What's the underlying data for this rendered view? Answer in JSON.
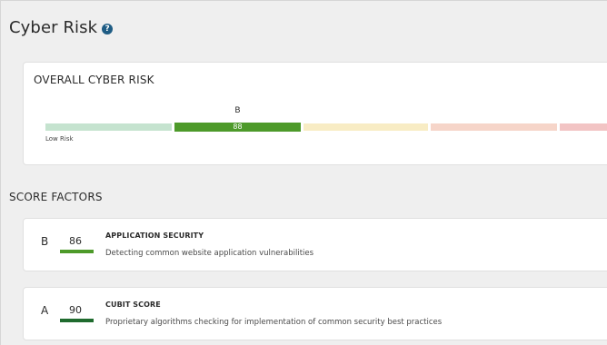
{
  "page": {
    "title": "Cyber Risk",
    "help_icon": "question-icon",
    "help_glyph": "?"
  },
  "overall": {
    "title": "OVERALL CYBER RISK",
    "scale": [
      {
        "color": "#c5e3cf"
      },
      {
        "color": "#4d9a2a",
        "current": true
      },
      {
        "color": "#f8ecc4"
      },
      {
        "color": "#f6d5c9"
      },
      {
        "color": "#f2c4c4"
      }
    ],
    "current_grade": "B",
    "current_score": "88",
    "low_label": "Low Risk"
  },
  "score_factors": {
    "title": "SCORE FACTORS",
    "items": [
      {
        "grade": "B",
        "score": "86",
        "bar_color": "#4d9a2a",
        "name": "APPLICATION SECURITY",
        "description": "Detecting common website application vulnerabilities"
      },
      {
        "grade": "A",
        "score": "90",
        "bar_color": "#1f6b2e",
        "name": "CUBIT SCORE",
        "description": "Proprietary algorithms checking for implementation of common security best practices"
      }
    ]
  }
}
